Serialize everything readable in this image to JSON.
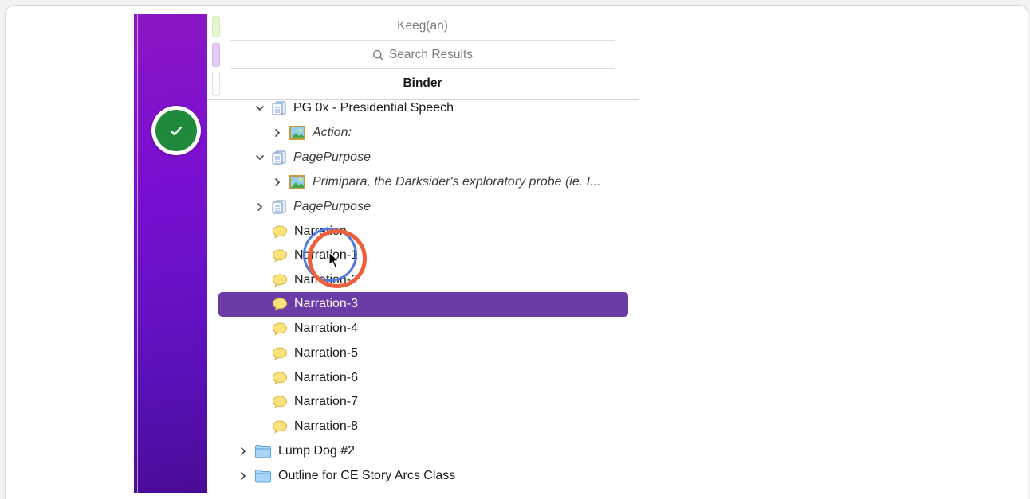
{
  "header": {
    "project_title": "Keeg(an)",
    "search_label": "Search Results",
    "binder_label": "Binder"
  },
  "colors": {
    "accent": "#6b3ba6",
    "sidebar_purple": "#7a0fd0",
    "badge_green": "#1f8a3c",
    "strip_green": "#e7f6d2",
    "strip_purple": "#e3cdf4"
  },
  "binder": {
    "items": [
      {
        "label": "PG 0x - Presidential Speech",
        "icon": "text-doc-icon",
        "expanded": true
      },
      {
        "label": "Action:",
        "icon": "image-icon",
        "expanded": false
      },
      {
        "label": "PagePurpose",
        "icon": "text-doc-icon",
        "expanded": true
      },
      {
        "label": "Primipara, the Darksider's exploratory probe (ie. I...",
        "icon": "image-icon",
        "expanded": false
      },
      {
        "label": "PagePurpose",
        "icon": "text-doc-icon",
        "expanded": false
      },
      {
        "label": "Narration",
        "icon": "speech-bubble-icon"
      },
      {
        "label": "Narration-1",
        "icon": "speech-bubble-icon"
      },
      {
        "label": "Narration-2",
        "icon": "speech-bubble-icon"
      },
      {
        "label": "Narration-3",
        "icon": "speech-bubble-icon",
        "selected": true
      },
      {
        "label": "Narration-4",
        "icon": "speech-bubble-icon"
      },
      {
        "label": "Narration-5",
        "icon": "speech-bubble-icon"
      },
      {
        "label": "Narration-6",
        "icon": "speech-bubble-icon"
      },
      {
        "label": "Narration-7",
        "icon": "speech-bubble-icon"
      },
      {
        "label": "Narration-8",
        "icon": "speech-bubble-icon"
      },
      {
        "label": "Lump Dog #2",
        "icon": "folder-icon",
        "expanded": false
      },
      {
        "label": "Outline for CE Story Arcs Class",
        "icon": "folder-icon",
        "expanded": false
      }
    ]
  }
}
